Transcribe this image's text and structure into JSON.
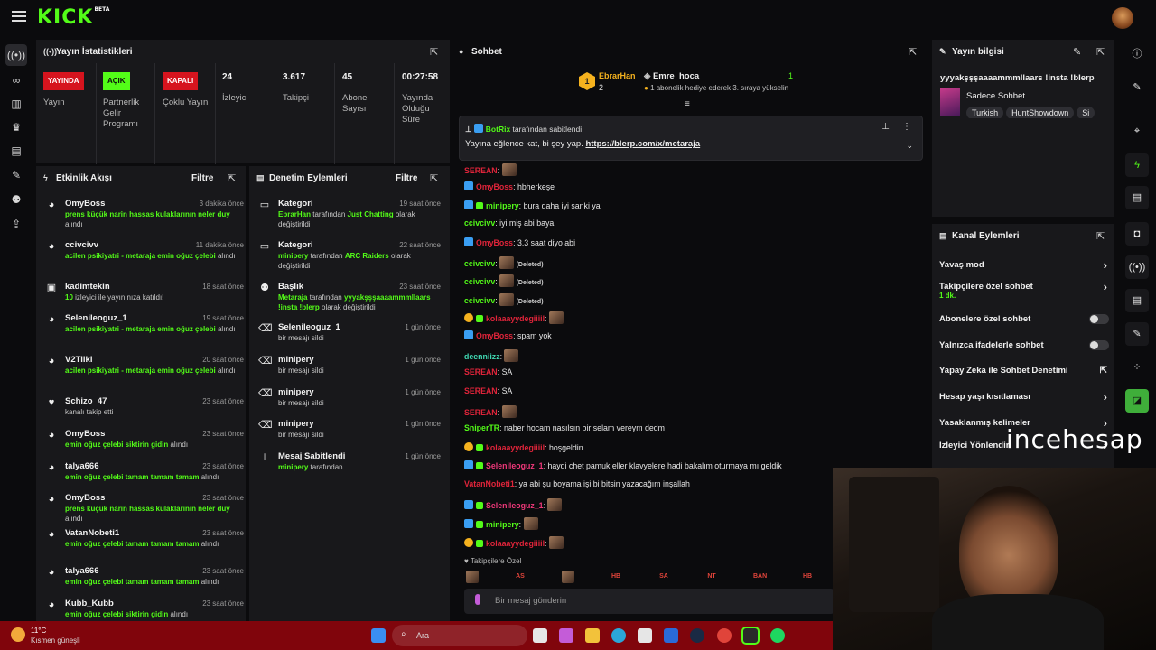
{
  "app": {
    "logo": "KICK",
    "beta": "BETA"
  },
  "stats": {
    "title": "Yayın İstatistikleri",
    "items": [
      {
        "badge": "YAYINDA",
        "label": "Yayın"
      },
      {
        "badge": "AÇIK",
        "label": "Partnerlik Gelir Programı"
      },
      {
        "badge": "KAPALI",
        "label": "Çoklu Yayın"
      },
      {
        "value": "24",
        "label": "İzleyici"
      },
      {
        "value": "3.617",
        "label": "Takipçi"
      },
      {
        "value": "45",
        "label": "Abone Sayısı"
      },
      {
        "value": "00:27:58",
        "label": "Yayında Olduğu Süre"
      }
    ]
  },
  "activity": {
    "title": "Etkinlik Akışı",
    "filter": "Filtre",
    "items": [
      {
        "name": "OmyBoss",
        "time": "3 dakika önce",
        "hl": "prens küçük narin hassas kulaklarının neler duy",
        "rest": "alındı"
      },
      {
        "name": "ccivcivv",
        "time": "11 dakika önce",
        "hl": "acilen psikiyatri - metaraja emin oğuz çelebi",
        "rest": "alındı"
      },
      {
        "name": "kadimtekin",
        "time": "18 saat önce",
        "hl": "10",
        "rest": "izleyici ile yayınınıza katıldı!"
      },
      {
        "name": "Selenileoguz_1",
        "time": "19 saat önce",
        "hl": "acilen psikiyatri - metaraja emin oğuz çelebi",
        "rest": "alındı"
      },
      {
        "name": "V2Tilki",
        "time": "20 saat önce",
        "hl": "acilen psikiyatri - metaraja emin oğuz çelebi",
        "rest": "alındı"
      },
      {
        "name": "Schizo_47",
        "time": "23 saat önce",
        "hl": "",
        "rest": "kanalı takip etti"
      },
      {
        "name": "OmyBoss",
        "time": "23 saat önce",
        "hl": "emin oğuz çelebi siktirin gidin",
        "rest": "alındı"
      },
      {
        "name": "talya666",
        "time": "23 saat önce",
        "hl": "emin oğuz çelebi tamam tamam tamam",
        "rest": "alındı"
      },
      {
        "name": "OmyBoss",
        "time": "23 saat önce",
        "hl": "prens küçük narin hassas kulaklarının neler duy",
        "rest": "alındı"
      },
      {
        "name": "VatanNobeti1",
        "time": "23 saat önce",
        "hl": "emin oğuz çelebi tamam tamam tamam",
        "rest": "alındı"
      },
      {
        "name": "talya666",
        "time": "23 saat önce",
        "hl": "emin oğuz çelebi tamam tamam tamam",
        "rest": "alındı"
      },
      {
        "name": "Kubb_Kubb",
        "time": "23 saat önce",
        "hl": "emin oğuz çelebi siktirin gidin",
        "rest": "alındı"
      }
    ]
  },
  "moderation": {
    "title": "Denetim Eylemleri",
    "filter": "Filtre",
    "items": [
      {
        "name": "Kategori",
        "time": "19 saat önce",
        "who": "EbrarHan",
        "mid": "tarafından",
        "val": "Just Chatting",
        "end": "olarak değiştirildi"
      },
      {
        "name": "Kategori",
        "time": "22 saat önce",
        "who": "minipery",
        "mid": "tarafından",
        "val": "ARC Raiders",
        "end": "olarak değiştirildi"
      },
      {
        "name": "Başlık",
        "time": "23 saat önce",
        "who": "Metaraja",
        "mid": "tarafından",
        "val": "yyyakşşşaaaammmllaars !insta !blerp",
        "end": "olarak değiştirildi"
      },
      {
        "name": "Selenileoguz_1",
        "time": "1 gün önce",
        "who": "",
        "mid": "",
        "val": "",
        "end": "bir mesajı sildi"
      },
      {
        "name": "minipery",
        "time": "1 gün önce",
        "who": "",
        "mid": "",
        "val": "",
        "end": "bir mesajı sildi"
      },
      {
        "name": "minipery",
        "time": "1 gün önce",
        "who": "",
        "mid": "",
        "val": "",
        "end": "bir mesajı sildi"
      },
      {
        "name": "minipery",
        "time": "1 gün önce",
        "who": "",
        "mid": "",
        "val": "",
        "end": "bir mesajı sildi"
      },
      {
        "name": "Mesaj Sabitlendi",
        "time": "1 gün önce",
        "who": "minipery",
        "mid": "tarafından",
        "val": "",
        "end": ""
      }
    ]
  },
  "chat": {
    "title": "Sohbet",
    "gift": {
      "level": "1",
      "name1": "EbrarHan",
      "count1": "2",
      "name2": "Emre_hoca",
      "count2": "1",
      "desc": "1 abonelik hediye ederek 3. sıraya yükselin"
    },
    "pinned": {
      "by": "BotRix",
      "by_suffix": "tarafından sabitlendi",
      "text": "Yayına eğlence kat, bi şey yap.",
      "link": "https://blerp.com/x/metaraja"
    },
    "messages": [
      {
        "user": "SEREAN",
        "color": "#e0243a",
        "text": ""
      },
      {
        "user": "OmyBoss",
        "color": "#e0243a",
        "text": "hbherkeşe"
      },
      {
        "user": "minipery",
        "color": "#53fc18",
        "text": "bura daha iyi sanki ya"
      },
      {
        "user": "ccivcivv",
        "color": "#53fc18",
        "text": "iyi miş abi baya"
      },
      {
        "user": "OmyBoss",
        "color": "#e0243a",
        "text": "3.3 saat diyo abi"
      },
      {
        "user": "ccivcivv",
        "color": "#53fc18",
        "text": "(Deleted)"
      },
      {
        "user": "ccivcivv",
        "color": "#53fc18",
        "text": "(Deleted)"
      },
      {
        "user": "ccivcivv",
        "color": "#53fc18",
        "text": "(Deleted)"
      },
      {
        "user": "kolaaayydegiiiil",
        "color": "#e0243a",
        "text": ""
      },
      {
        "user": "OmyBoss",
        "color": "#e0243a",
        "text": "spam yok"
      },
      {
        "user": "deenniizz",
        "color": "#3fd6b0",
        "text": ""
      },
      {
        "user": "SEREAN",
        "color": "#e0243a",
        "text": "SA"
      },
      {
        "user": "SEREAN",
        "color": "#e0243a",
        "text": "SA"
      },
      {
        "user": "SEREAN",
        "color": "#e0243a",
        "text": ""
      },
      {
        "user": "SniperTR",
        "color": "#53fc18",
        "text": "naber hocam nasılsın bir selam vereym dedm"
      },
      {
        "user": "kolaaayydegiiiil",
        "color": "#e0243a",
        "text": "hoşgeldin"
      },
      {
        "user": "Selenileoguz_1",
        "color": "#f0387a",
        "text": "haydi chet pamuk eller klavyelere hadi bakalım oturmaya mı geldik"
      },
      {
        "user": "VatanNobeti1",
        "color": "#e0243a",
        "text": "ya abi şu boyama işi bi bitsin yazacağım inşallah"
      },
      {
        "user": "Selenileoguz_1",
        "color": "#f0387a",
        "text": ""
      },
      {
        "user": "minipery",
        "color": "#53fc18",
        "text": ""
      },
      {
        "user": "kolaaayydegiiiil",
        "color": "#e0243a",
        "text": ""
      }
    ],
    "follower_only": "Takipçilere Özel",
    "emotes": [
      "",
      "AS",
      "",
      "HB",
      "SA",
      "NT",
      "BAN",
      "HB"
    ],
    "input_placeholder": "Bir mesaj gönderin"
  },
  "streaminfo": {
    "title": "Yayın bilgisi",
    "stream_title": "yyyakşşşaaaammmllaars !insta !blerp",
    "category": "Sadece Sohbet",
    "tags": [
      "Turkish",
      "HuntShowdown",
      "Si"
    ]
  },
  "channel": {
    "title": "Kanal Eylemleri",
    "items": [
      {
        "label": "Yavaş mod",
        "control": "chevron"
      },
      {
        "label": "Takipçilere özel sohbet",
        "sub": "1 dk.",
        "control": "chevron"
      },
      {
        "label": "Abonelere özel sohbet",
        "control": "toggle"
      },
      {
        "label": "Yalnızca ifadelerle sohbet",
        "control": "toggle"
      },
      {
        "label": "Yapay Zeka ile Sohbet Denetimi",
        "control": "external"
      },
      {
        "label": "Hesap yaşı kısıtlaması",
        "control": "chevron"
      },
      {
        "label": "Yasaklanmış kelimeler",
        "control": "chevron"
      },
      {
        "label": "İzleyici Yönlendir",
        "control": "chevron"
      }
    ]
  },
  "overlay": {
    "watermark": "incehesap"
  },
  "taskbar": {
    "temp": "11°C",
    "weather": "Kısmen güneşli",
    "search": "Ara"
  }
}
